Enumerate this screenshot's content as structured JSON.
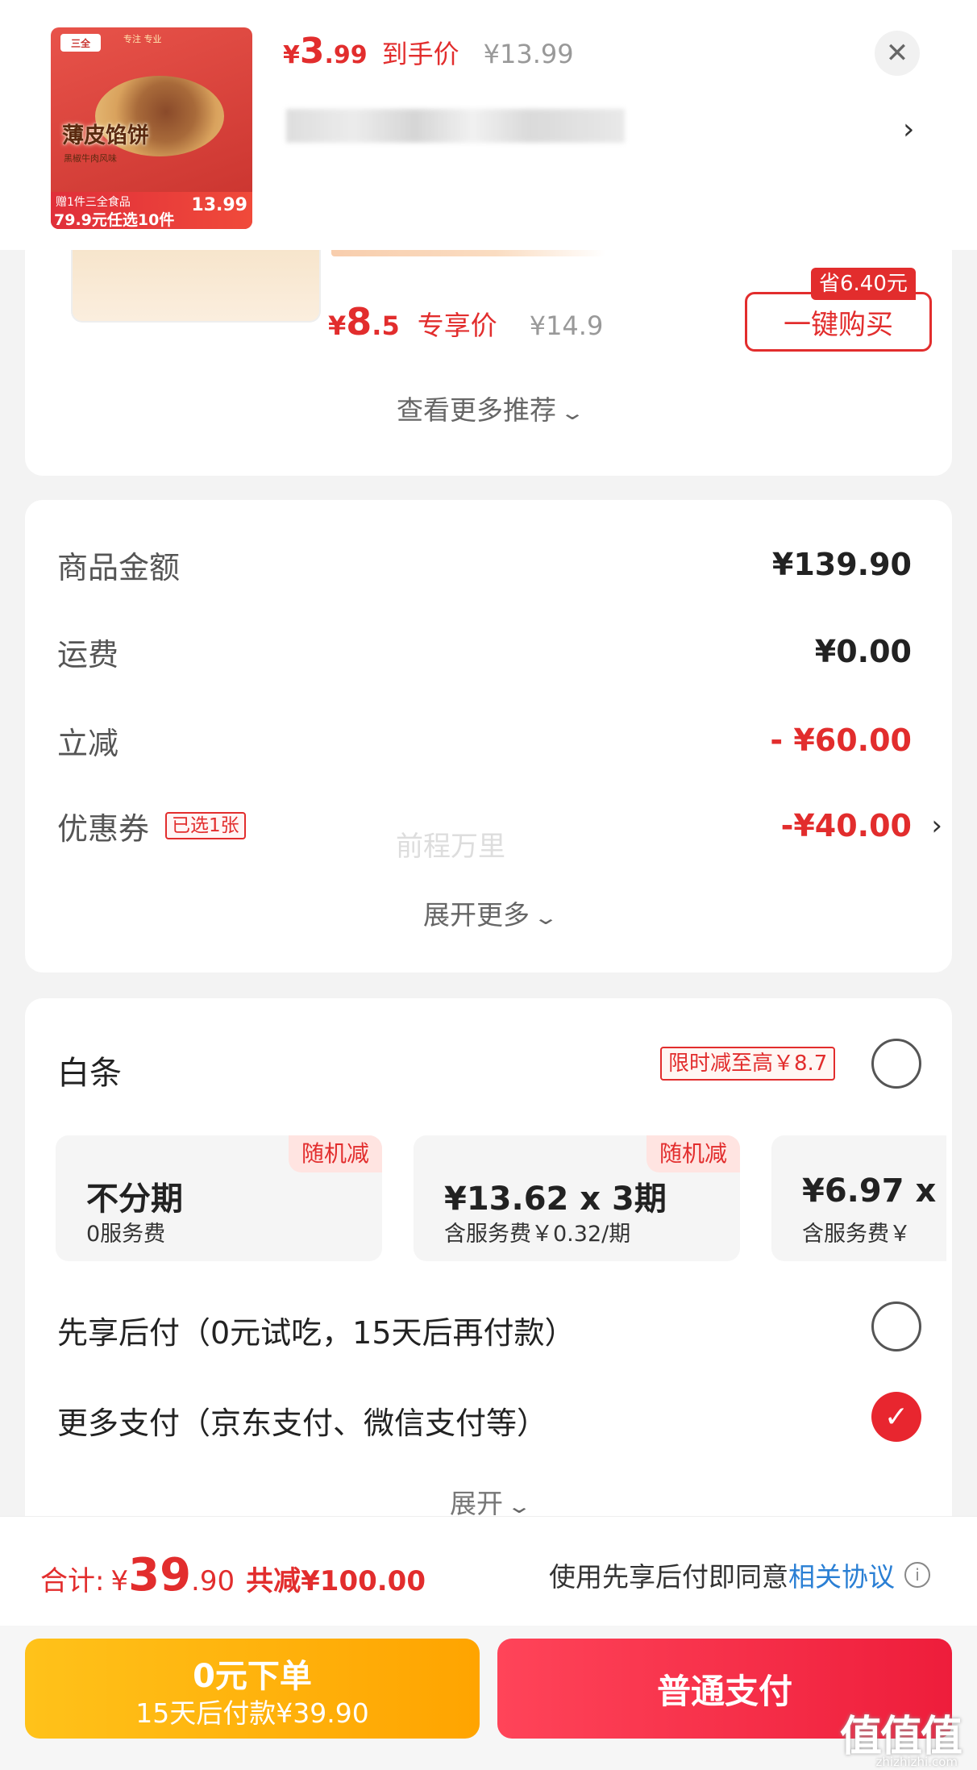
{
  "header": {
    "price_symbol": "¥",
    "price_int": "3",
    "price_dec": ".99",
    "price_label": "到手价",
    "original_price": "¥13.99",
    "close_icon": "close-icon",
    "thumb": {
      "brand": "三全",
      "tag": "专注 专业",
      "title": "薄皮馅饼",
      "subtitle": "黑椒牛肉风味",
      "badge_line1": "赠1件三全食品",
      "badge_line2": "79.9元任选10件",
      "badge_price": "13.99"
    }
  },
  "recommend": {
    "save_badge": "省6.40元",
    "price_symbol": "¥",
    "price_int": "8",
    "price_dec": ".5",
    "price_label": "专享价",
    "original_price": "¥14.9",
    "buy_button": "一键购买",
    "more_label": "查看更多推荐"
  },
  "amount": {
    "rows": [
      {
        "label": "商品金额",
        "value": "¥139.90"
      },
      {
        "label": "运费",
        "value": "¥0.00"
      },
      {
        "label": "立减",
        "value": "- ¥60.00"
      },
      {
        "label": "优惠券",
        "tag": "已选1张",
        "value": "-¥40.00"
      }
    ],
    "watermark": "前程万里",
    "expand_label": "展开更多"
  },
  "payment": {
    "baitiao_title": "白条",
    "promo": "限时减至高￥8.7",
    "installments": [
      {
        "badge": "随机减",
        "main": "不分期",
        "sub": "0服务费"
      },
      {
        "badge": "随机减",
        "main": "¥13.62 x 3期",
        "sub": "含服务费￥0.32/期"
      },
      {
        "badge": "",
        "main": "¥6.97 x",
        "sub": "含服务费￥"
      }
    ],
    "options": [
      {
        "label": "先享后付（0元试吃，15天后再付款）",
        "checked": false
      },
      {
        "label": "更多支付（京东支付、微信支付等）",
        "checked": true
      }
    ],
    "expand_label": "展开"
  },
  "summary": {
    "total_label": "合计:",
    "total_symbol": "¥",
    "total_int": "39",
    "total_dec": ".90",
    "saved": "共减¥100.00",
    "agree_text": "使用先享后付即同意",
    "agree_link": "相关协议"
  },
  "buttons": {
    "bnpl_title": "0元下单",
    "bnpl_sub": "15天后付款¥39.90",
    "pay": "普通支付"
  },
  "watermark_site": {
    "logo": "值值值",
    "url": "zhizhizhi.com"
  },
  "colors": {
    "accent_red": "#e22d2d",
    "link_blue": "#2a7fd4",
    "bnpl_yellow": "#ffb000"
  }
}
